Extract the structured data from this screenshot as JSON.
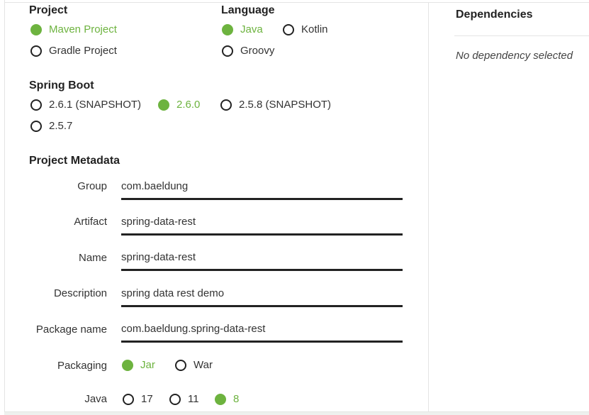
{
  "project": {
    "title": "Project",
    "options": [
      {
        "label": "Maven Project",
        "checked": true
      },
      {
        "label": "Gradle Project",
        "checked": false
      }
    ]
  },
  "language": {
    "title": "Language",
    "options": [
      {
        "label": "Java",
        "checked": true
      },
      {
        "label": "Kotlin",
        "checked": false
      },
      {
        "label": "Groovy",
        "checked": false
      }
    ]
  },
  "spring_boot": {
    "title": "Spring Boot",
    "options": [
      {
        "label": "2.6.1 (SNAPSHOT)",
        "checked": false
      },
      {
        "label": "2.6.0",
        "checked": true
      },
      {
        "label": "2.5.8 (SNAPSHOT)",
        "checked": false
      },
      {
        "label": "2.5.7",
        "checked": false
      }
    ]
  },
  "metadata": {
    "title": "Project Metadata",
    "fields": [
      {
        "label": "Group",
        "value": "com.baeldung"
      },
      {
        "label": "Artifact",
        "value": "spring-data-rest"
      },
      {
        "label": "Name",
        "value": "spring-data-rest"
      },
      {
        "label": "Description",
        "value": "spring data rest demo"
      },
      {
        "label": "Package name",
        "value": "com.baeldung.spring-data-rest"
      }
    ],
    "packaging": {
      "label": "Packaging",
      "options": [
        {
          "label": "Jar",
          "checked": true
        },
        {
          "label": "War",
          "checked": false
        }
      ]
    },
    "java": {
      "label": "Java",
      "options": [
        {
          "label": "17",
          "checked": false
        },
        {
          "label": "11",
          "checked": false
        },
        {
          "label": "8",
          "checked": true
        }
      ]
    }
  },
  "dependencies": {
    "title": "Dependencies",
    "empty_text": "No dependency selected"
  },
  "colors": {
    "accent": "#6db33f",
    "text": "#222222",
    "border": "#e4e4e4"
  }
}
